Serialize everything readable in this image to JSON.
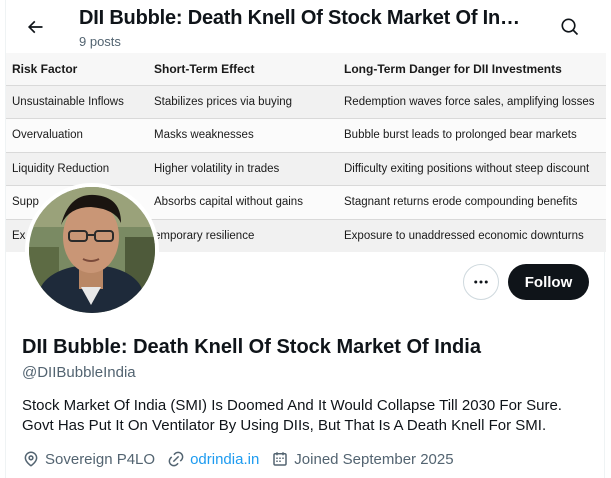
{
  "header": {
    "title": "DII Bubble: Death Knell Of Stock Market Of In…",
    "posts": "9 posts"
  },
  "banner": {
    "headers": [
      "Risk Factor",
      "Short-Term Effect",
      "Long-Term Danger for DII Investments"
    ],
    "rows": [
      [
        "Unsustainable Inflows",
        "Stabilizes prices via buying",
        "Redemption waves force sales, amplifying losses"
      ],
      [
        "Overvaluation",
        "Masks weaknesses",
        "Bubble burst leads to prolonged bear markets"
      ],
      [
        "Liquidity Reduction",
        "Higher volatility in trades",
        "Difficulty exiting positions without steep discount"
      ],
      [
        "Supp",
        "Absorbs capital without gains",
        "Stagnant returns erode compounding benefits"
      ],
      [
        "Ex",
        "emporary resilience",
        "Exposure to unaddressed economic downturns"
      ]
    ]
  },
  "profile": {
    "name": "DII Bubble: Death Knell Of Stock Market Of India",
    "handle": "@DIIBubbleIndia",
    "bio": "Stock Market Of India (SMI) Is Doomed And It Would Collapse Till 2030 For Sure. Govt Has Put It On Ventilator By Using DIIs, But That Is A Death Knell For SMI.",
    "location": "Sovereign P4LO",
    "website": "odrindia.in",
    "joined": "Joined September 2025"
  },
  "actions": {
    "follow_label": "Follow"
  },
  "colors": {
    "accent": "#1d9bf0",
    "text": "#0f1419",
    "secondary": "#536471",
    "follow_bg": "#0f1419"
  },
  "icons": [
    "back-arrow-icon",
    "search-icon",
    "more-icon",
    "location-icon",
    "link-icon",
    "calendar-icon"
  ]
}
